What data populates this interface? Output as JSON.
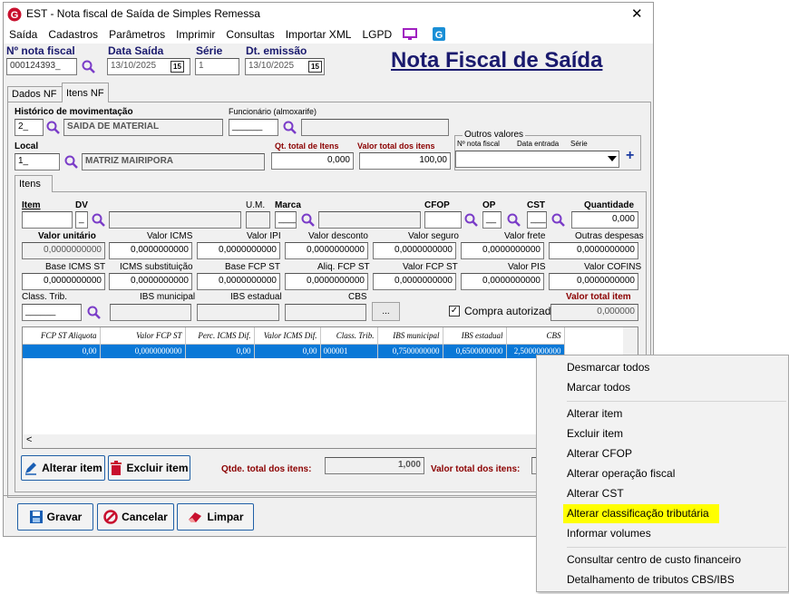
{
  "window": {
    "title": "EST - Nota fiscal de Saída de Simples Remessa",
    "close_glyph": "✕"
  },
  "menu": [
    "Saída",
    "Cadastros",
    "Parâmetros",
    "Imprimir",
    "Consultas",
    "Importar XML",
    "LGPD"
  ],
  "header": {
    "nota_label": "Nº nota fiscal",
    "nota_value": "000124393_",
    "data_saida_label": "Data Saída",
    "data_saida_value": "13/10/2025",
    "serie_label": "Série",
    "serie_value": "1",
    "dt_emissao_label": "Dt. emissão",
    "dt_emissao_value": "13/10/2025",
    "big_title": "Nota Fiscal de Saída",
    "cal_glyph": "15"
  },
  "tabs": {
    "t1": "Dados NF",
    "t2": "Itens NF",
    "inner": "Itens"
  },
  "form": {
    "historico_label": "Histórico de movimentação",
    "historico_code": "2_",
    "historico_desc": "SAIDA DE MATERIAL",
    "funcionario_label": "Funcionário (almoxarife)",
    "funcionario_code": "______",
    "local_label": "Local",
    "local_code": "1_",
    "local_desc": "MATRIZ MAIRIPORA",
    "qt_total_label": "Qt. total de Itens",
    "qt_total_value": "0,000",
    "valor_total_label": "Valor total dos itens",
    "valor_total_value": "100,00",
    "outros_label": "Outros valores",
    "outros_nota": "Nº nota fiscal",
    "outros_data": "Data entrada",
    "outros_serie": "Série",
    "plus": "+"
  },
  "item": {
    "item_label": "Item",
    "dv_label": "DV",
    "dv_value": "_",
    "um_label": "U.M.",
    "marca_label": "Marca",
    "marca_value": "____",
    "cfop_label": "CFOP",
    "op_label": "OP",
    "op_value": "__",
    "cst_label": "CST",
    "cst_value": "___",
    "qtd_label": "Quantidade",
    "qtd_value": "0,000",
    "row1_labels": [
      "Valor unitário",
      "Valor ICMS",
      "Valor IPI",
      "Valor desconto",
      "Valor seguro",
      "Valor frete",
      "Outras despesas"
    ],
    "row1_values": [
      "0,0000000000",
      "0,0000000000",
      "0,0000000000",
      "0,0000000000",
      "0,0000000000",
      "0,0000000000",
      "0,0000000000"
    ],
    "row2_labels": [
      "Base ICMS ST",
      "ICMS substituição",
      "Base FCP ST",
      "Aliq. FCP ST",
      "Valor FCP ST",
      "Valor PIS",
      "Valor COFINS"
    ],
    "row2_values": [
      "0,0000000000",
      "0,0000000000",
      "0,0000000000",
      "0,0000000000",
      "0,0000000000",
      "0,0000000000",
      "0,0000000000"
    ],
    "class_label": "Class. Trib.",
    "class_value": "______",
    "ibs_mun_label": "IBS municipal",
    "ibs_est_label": "IBS estadual",
    "cbs_label": "CBS",
    "dots": "...",
    "compra_label": "Compra autorizada",
    "check": "✓",
    "valor_item_label": "Valor total item",
    "valor_item_value": "0,000000"
  },
  "grid": {
    "headers": [
      "FCP ST Aliquota",
      "Valor FCP ST",
      "Perc. ICMS Dif.",
      "Valor ICMS Dif.",
      "Class. Trib.",
      "IBS municipal",
      "IBS estadual",
      "CBS"
    ],
    "row": [
      "0,00",
      "0,0000000000",
      "0,00",
      "0,00",
      "000001",
      "0,7500000000",
      "0,6500000000",
      "2,5000000000"
    ],
    "scroll_left": "<"
  },
  "bottom": {
    "alterar": "Alterar item",
    "excluir": "Excluir item",
    "qtde_label": "Qtde. total dos itens:",
    "qtde_value": "1,000",
    "valor_label": "Valor total dos itens:",
    "gravar": "Gravar",
    "cancelar": "Cancelar",
    "limpar": "Limpar"
  },
  "context_menu": [
    "Desmarcar todos",
    "Marcar todos",
    "Alterar item",
    "Excluir item",
    "Alterar CFOP",
    "Alterar operação fiscal",
    "Alterar CST",
    "Alterar classificação tributária",
    "Informar volumes",
    "Consultar centro de custo financeiro",
    "Detalhamento de tributos CBS/IBS"
  ],
  "colors": {
    "highlight": "#ffff00",
    "selection": "#0a78d7",
    "title_blue": "#1a1a6e",
    "label_red": "#8b0000"
  }
}
